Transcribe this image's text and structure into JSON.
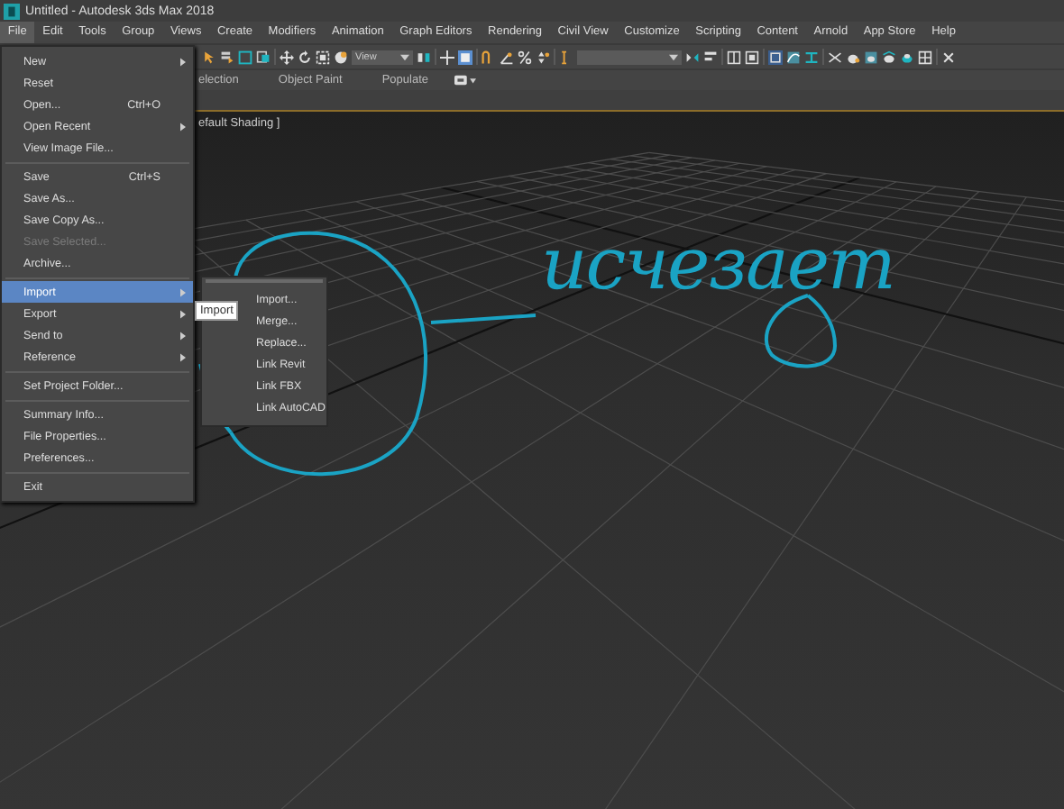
{
  "window": {
    "title": "Untitled - Autodesk 3ds Max 2018"
  },
  "menu_bar": [
    {
      "label": "File",
      "selected": true
    },
    {
      "label": "Edit",
      "selected": false
    },
    {
      "label": "Tools",
      "selected": false
    },
    {
      "label": "Group",
      "selected": false
    },
    {
      "label": "Views",
      "selected": false
    },
    {
      "label": "Create",
      "selected": false
    },
    {
      "label": "Modifiers",
      "selected": false
    },
    {
      "label": "Animation",
      "selected": false
    },
    {
      "label": "Graph Editors",
      "selected": false
    },
    {
      "label": "Rendering",
      "selected": false
    },
    {
      "label": "Civil View",
      "selected": false
    },
    {
      "label": "Customize",
      "selected": false
    },
    {
      "label": "Scripting",
      "selected": false
    },
    {
      "label": "Content",
      "selected": false
    },
    {
      "label": "Arnold",
      "selected": false
    },
    {
      "label": "App Store",
      "selected": false
    },
    {
      "label": "Help",
      "selected": false
    }
  ],
  "toolbar": {
    "coordinate_dropdown": "View"
  },
  "ribbon_tabs": [
    "election",
    "Object Paint",
    "Populate"
  ],
  "viewport": {
    "label": "efault Shading ]"
  },
  "file_menu": [
    {
      "kind": "item",
      "label": "New",
      "submenu": true,
      "selected": false,
      "disabled": false
    },
    {
      "kind": "item",
      "label": "Reset",
      "submenu": false,
      "selected": false,
      "disabled": false
    },
    {
      "kind": "item",
      "label": "Open...",
      "shortcut": "Ctrl+O",
      "submenu": false,
      "selected": false,
      "disabled": false
    },
    {
      "kind": "item",
      "label": "Open Recent",
      "submenu": true,
      "selected": false,
      "disabled": false
    },
    {
      "kind": "item",
      "label": "View Image File...",
      "submenu": false,
      "selected": false,
      "disabled": false
    },
    {
      "kind": "separator"
    },
    {
      "kind": "item",
      "label": "Save",
      "shortcut": "Ctrl+S",
      "submenu": false,
      "selected": false,
      "disabled": false
    },
    {
      "kind": "item",
      "label": "Save As...",
      "submenu": false,
      "selected": false,
      "disabled": false
    },
    {
      "kind": "item",
      "label": "Save Copy As...",
      "submenu": false,
      "selected": false,
      "disabled": false
    },
    {
      "kind": "item",
      "label": "Save Selected...",
      "submenu": false,
      "selected": false,
      "disabled": true
    },
    {
      "kind": "item",
      "label": "Archive...",
      "submenu": false,
      "selected": false,
      "disabled": false
    },
    {
      "kind": "separator"
    },
    {
      "kind": "item",
      "label": "Import",
      "submenu": true,
      "selected": true,
      "disabled": false
    },
    {
      "kind": "item",
      "label": "Export",
      "submenu": true,
      "selected": false,
      "disabled": false
    },
    {
      "kind": "item",
      "label": "Send to",
      "submenu": true,
      "selected": false,
      "disabled": false
    },
    {
      "kind": "item",
      "label": "Reference",
      "submenu": true,
      "selected": false,
      "disabled": false
    },
    {
      "kind": "separator"
    },
    {
      "kind": "item",
      "label": "Set Project Folder...",
      "submenu": false,
      "selected": false,
      "disabled": false
    },
    {
      "kind": "separator"
    },
    {
      "kind": "item",
      "label": "Summary Info...",
      "submenu": false,
      "selected": false,
      "disabled": false
    },
    {
      "kind": "item",
      "label": "File Properties...",
      "submenu": false,
      "selected": false,
      "disabled": false
    },
    {
      "kind": "item",
      "label": "Preferences...",
      "submenu": false,
      "selected": false,
      "disabled": false
    },
    {
      "kind": "separator"
    },
    {
      "kind": "item",
      "label": "Exit",
      "submenu": false,
      "selected": false,
      "disabled": false
    }
  ],
  "import_submenu": [
    "Import...",
    "Merge...",
    "Replace...",
    "Link Revit",
    "Link FBX",
    "Link AutoCAD"
  ],
  "tooltip": "Import",
  "annotation": {
    "text": "исчезает"
  }
}
